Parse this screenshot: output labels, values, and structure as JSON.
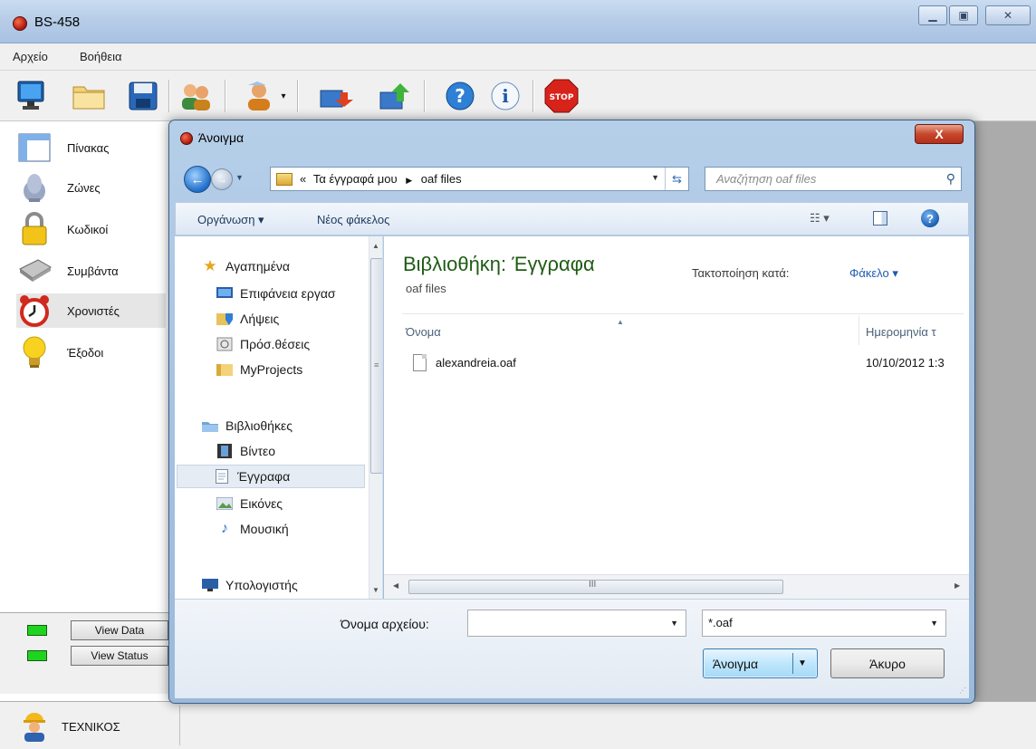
{
  "app": {
    "title": "BS-458"
  },
  "menu": [
    "Αρχείο",
    "Βοήθεια"
  ],
  "toolbar": {
    "icons": [
      "monitor-icon",
      "folder-icon",
      "save-icon",
      "users-icon",
      "user-dropdown-icon",
      "download-icon",
      "upload-icon",
      "help-icon",
      "info-icon",
      "stop-icon"
    ],
    "stop_text": "STOP"
  },
  "sidebar": {
    "items": [
      {
        "label": "Πίνακας",
        "icon": "table-icon"
      },
      {
        "label": "Ζώνες",
        "icon": "zones-icon"
      },
      {
        "label": "Κωδικοί",
        "icon": "lock-icon"
      },
      {
        "label": "Συμβάντα",
        "icon": "events-icon"
      },
      {
        "label": "Χρονιστές",
        "icon": "alarm-clock-icon"
      },
      {
        "label": "Έξοδοι",
        "icon": "lightbulb-icon"
      }
    ],
    "selected": "Χρονιστές",
    "view_data": "View Data",
    "view_status": "View Status"
  },
  "statusbar": {
    "user": "ΤΕΧΝΙΚΟΣ"
  },
  "dialog": {
    "title": "Άνοιγμα",
    "close": "X",
    "address": {
      "prefix": "«",
      "path_parts": [
        "Τα έγγραφά μου",
        "oaf files"
      ]
    },
    "search_placeholder": "Αναζήτηση oaf files",
    "commands": {
      "organize": "Οργάνωση ▾",
      "new_folder": "Νέος φάκελος",
      "view": "☷ ▾",
      "help": "?"
    },
    "nav": {
      "favorites": "Αγαπημένα",
      "desktop": "Επιφάνεια εργασ",
      "downloads": "Λήψεις",
      "recent": "Πρόσ.θέσεις",
      "myprojects": "MyProjects",
      "libraries": "Βιβλιοθήκες",
      "videos": "Βίντεο",
      "documents": "Έγγραφα",
      "pictures": "Εικόνες",
      "music": "Μουσική",
      "computer": "Υπολογιστής"
    },
    "content": {
      "library_title": "Βιβλιοθήκη: Έγγραφα",
      "library_sub": "oaf files",
      "sort_label": "Τακτοποίηση κατά:",
      "sort_value": "Φάκελο ▾",
      "col_name": "Όνομα",
      "col_date": "Ημερομηνία τ",
      "files": [
        {
          "name": "alexandreia.oaf",
          "date": "10/10/2012 1:3"
        }
      ]
    },
    "scroll_grip": "III",
    "filename_label": "Όνομα αρχείου:",
    "filename_value": "",
    "filetype_value": "*.oaf",
    "open_button": "Άνοιγμα",
    "cancel_button": "Άκυρο"
  }
}
